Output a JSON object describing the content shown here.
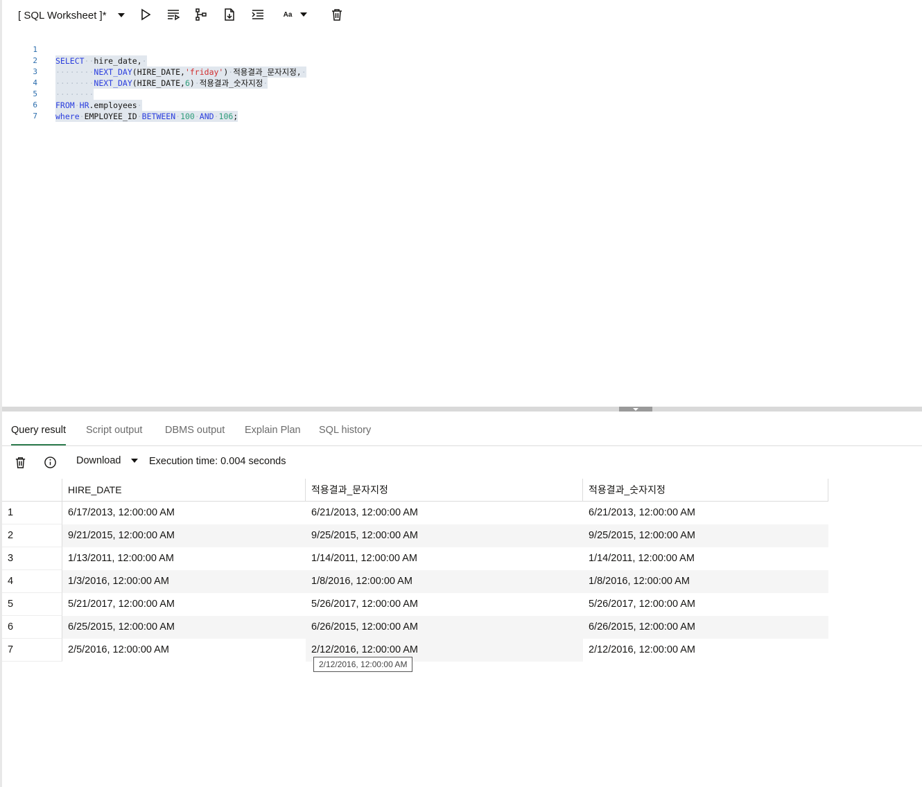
{
  "worksheet": {
    "title": "[ SQL Worksheet ]*",
    "toolbar_icons": [
      "run-statement-icon",
      "run-script-icon",
      "explain-plan-icon",
      "autotrace-icon",
      "format-icon",
      "case-icon",
      "clear-icon"
    ]
  },
  "editor": {
    "lines": [
      {
        "num": "1"
      },
      {
        "num": "2"
      },
      {
        "num": "3"
      },
      {
        "num": "4"
      },
      {
        "num": "5"
      },
      {
        "num": "6"
      },
      {
        "num": "7"
      }
    ],
    "tokens": {
      "select": "SELECT",
      "hire_date": "hire_date,",
      "next_day": "NEXT_DAY",
      "hire_date_arg": "(HIRE_DATE,",
      "friday": "'friday'",
      "close_paren": ")",
      "alias1": "적용결과_문자지정,",
      "six": "6",
      "alias2": "적용결과_숫자지정",
      "from": "FROM",
      "hr": "HR",
      "employees": ".employees",
      "where": "where",
      "employee_id": "EMPLOYEE_ID",
      "between": "BETWEEN",
      "n100": "100",
      "and": "AND",
      "n106": "106",
      "semi": ";"
    }
  },
  "tabs": [
    {
      "label": "Query result",
      "active": true
    },
    {
      "label": "Script output"
    },
    {
      "label": "DBMS output"
    },
    {
      "label": "Explain Plan"
    },
    {
      "label": "SQL history"
    }
  ],
  "result_toolbar": {
    "download_label": "Download",
    "execution_time": "Execution time: 0.004 seconds"
  },
  "grid": {
    "columns": [
      "HIRE_DATE",
      "적용결과_문자지정",
      "적용결과_숫자지정"
    ],
    "rows": [
      {
        "n": "1",
        "c": [
          "6/17/2013, 12:00:00 AM",
          "6/21/2013, 12:00:00 AM",
          "6/21/2013, 12:00:00 AM"
        ]
      },
      {
        "n": "2",
        "c": [
          "9/21/2015, 12:00:00 AM",
          "9/25/2015, 12:00:00 AM",
          "9/25/2015, 12:00:00 AM"
        ]
      },
      {
        "n": "3",
        "c": [
          "1/13/2011, 12:00:00 AM",
          "1/14/2011, 12:00:00 AM",
          "1/14/2011, 12:00:00 AM"
        ]
      },
      {
        "n": "4",
        "c": [
          "1/3/2016, 12:00:00 AM",
          "1/8/2016, 12:00:00 AM",
          "1/8/2016, 12:00:00 AM"
        ]
      },
      {
        "n": "5",
        "c": [
          "5/21/2017, 12:00:00 AM",
          "5/26/2017, 12:00:00 AM",
          "5/26/2017, 12:00:00 AM"
        ]
      },
      {
        "n": "6",
        "c": [
          "6/25/2015, 12:00:00 AM",
          "6/26/2015, 12:00:00 AM",
          "6/26/2015, 12:00:00 AM"
        ]
      },
      {
        "n": "7",
        "c": [
          "2/5/2016, 12:00:00 AM",
          "2/12/2016, 12:00:00 AM",
          "2/12/2016, 12:00:00 AM"
        ]
      }
    ],
    "tooltip": "2/12/2016, 12:00:00 AM"
  },
  "colors": {
    "keyword": "#2a3dde",
    "string": "#d12e2e",
    "number": "#2e9c7a",
    "selection": "#e1e7ee",
    "active_tab": "#2e7d4f",
    "stripe": "#f5f5f5"
  }
}
